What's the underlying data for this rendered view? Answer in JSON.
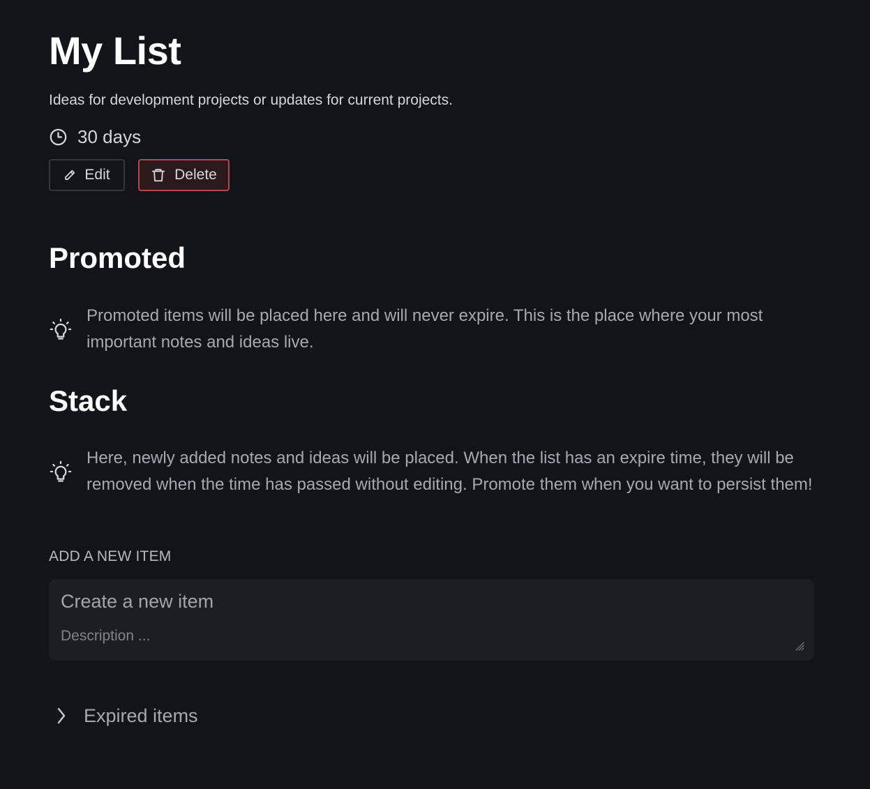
{
  "list": {
    "title": "My List",
    "description": "Ideas for development projects or updates for current projects.",
    "expire": {
      "icon": "clock-icon",
      "label": "30 days"
    },
    "actions": {
      "edit": {
        "label": "Edit",
        "icon": "pencil-icon"
      },
      "delete": {
        "label": "Delete",
        "icon": "trash-icon",
        "color": "#b4484b"
      }
    }
  },
  "promoted": {
    "title": "Promoted",
    "hint_icon": "lightbulb-icon",
    "hint": "Promoted items will be placed here and will never expire. This is the place where your most important notes and ideas live."
  },
  "stack": {
    "title": "Stack",
    "hint_icon": "lightbulb-icon",
    "hint": "Here, newly added notes and ideas will be placed. When the list has an expire time, they will be removed when the time has passed without editing. Promote them when you want to persist them!"
  },
  "new_item": {
    "label": "ADD A NEW ITEM",
    "title_placeholder": "Create a new item",
    "description_placeholder": "Description ..."
  },
  "expired": {
    "label": "Expired items",
    "icon": "chevron-right-icon"
  },
  "colors": {
    "background": "#111418",
    "input_background": "#1b1e23",
    "danger": "#b4484b"
  }
}
